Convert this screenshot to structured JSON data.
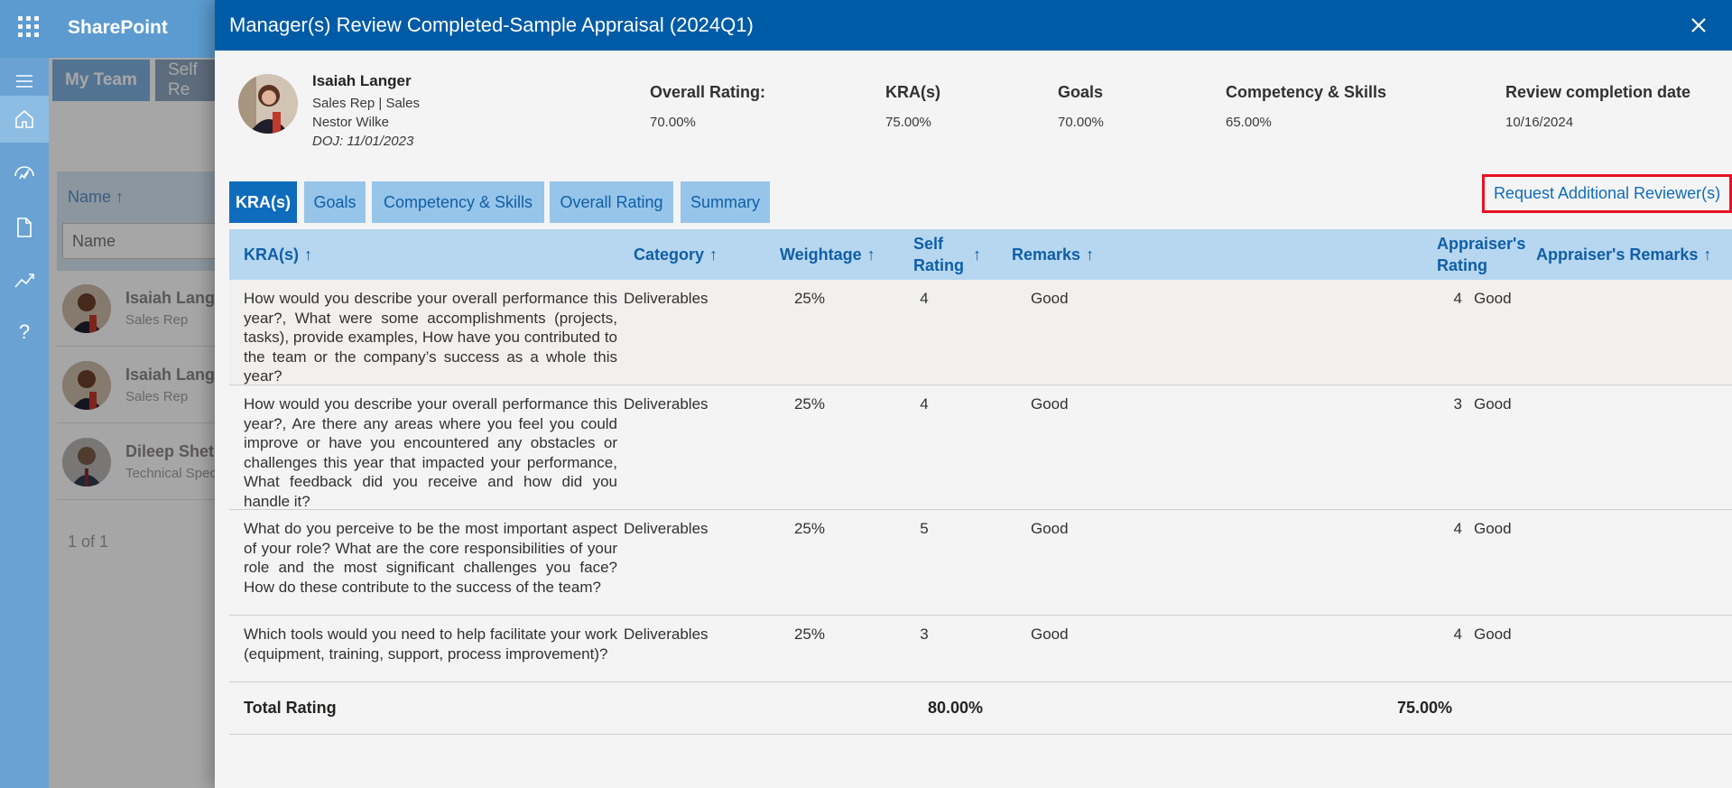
{
  "app": {
    "brand": "SharePoint",
    "tabs": [
      "My Team",
      "Self Re"
    ],
    "name_column_header": "Name ↑",
    "name_filter_placeholder": "Name",
    "people": [
      {
        "name": "Isaiah Lange",
        "role": "Sales Rep"
      },
      {
        "name": "Isaiah Lange",
        "role": "Sales Rep"
      },
      {
        "name": "Dileep Shet",
        "role": "Technical Spec"
      }
    ],
    "pager": "1 of 1",
    "rail_icons": [
      "menu-icon",
      "home-icon",
      "performance-icon",
      "document-icon",
      "chart-icon",
      "help-icon"
    ],
    "rail_help_glyph": "?"
  },
  "modal": {
    "title": "Manager(s) Review Completed-Sample Appraisal (2024Q1)",
    "employee": {
      "name": "Isaiah Langer",
      "title_dept": "Sales Rep | Sales",
      "manager": "Nestor Wilke",
      "doj": "DOJ: 11/01/2023"
    },
    "summary": [
      {
        "label": "Overall Rating:",
        "value": "70.00%"
      },
      {
        "label": "KRA(s)",
        "value": "75.00%"
      },
      {
        "label": "Goals",
        "value": "70.00%"
      },
      {
        "label": "Competency & Skills",
        "value": "65.00%"
      },
      {
        "label": "Review completion date",
        "value": "10/16/2024"
      }
    ],
    "tabs": [
      "KRA(s)",
      "Goals",
      "Competency & Skills",
      "Overall Rating",
      "Summary"
    ],
    "active_tab": "KRA(s)",
    "request_link": "Request Additional Reviewer(s)",
    "table": {
      "headers": {
        "kra": "KRA(s)",
        "category": "Category",
        "weightage": "Weightage",
        "self_rating_1": "Self",
        "self_rating_2": "Rating",
        "remarks": "Remarks",
        "appraiser_rating_1": "Appraiser's",
        "appraiser_rating_2": "Rating",
        "appraiser_remarks": "Appraiser's Remarks",
        "sort_arrow": "↑"
      },
      "rows": [
        {
          "kra": "How would you describe your overall performance this year?, What were some accomplishments (projects, tasks), provide examples, How have you contributed to the team or the company’s success as a whole this year?",
          "category": "Deliverables",
          "weightage": "25%",
          "self_rating": "4",
          "remarks": "Good",
          "appraiser_rating": "4",
          "appraiser_remarks": "Good"
        },
        {
          "kra": "How would you describe your overall performance this year?, Are there any areas where you feel you could improve or have you encountered any obstacles or challenges this year that impacted your performance, What feedback did you receive and how did you handle it?",
          "category": "Deliverables",
          "weightage": "25%",
          "self_rating": "4",
          "remarks": "Good",
          "appraiser_rating": "3",
          "appraiser_remarks": "Good"
        },
        {
          "kra": "What do you perceive to be the most important aspect of your role? What are the core responsibilities of your role and the most significant challenges you face? How do these contribute to the success of the team?",
          "category": "Deliverables",
          "weightage": "25%",
          "self_rating": "5",
          "remarks": "Good",
          "appraiser_rating": "4",
          "appraiser_remarks": "Good"
        },
        {
          "kra": "Which tools would you need to help facilitate your work (equipment, training, support, process improvement)?",
          "category": "Deliverables",
          "weightage": "25%",
          "self_rating": "3",
          "remarks": "Good",
          "appraiser_rating": "4",
          "appraiser_remarks": "Good"
        }
      ],
      "total": {
        "label": "Total Rating",
        "self": "80.00%",
        "appraiser": "75.00%"
      }
    }
  },
  "colors": {
    "header_blue": "#005ba7",
    "tab_active": "#0f6cbd",
    "tab_inactive": "#97c5ea",
    "table_header": "#b7d6ef",
    "highlight_red": "#e81123"
  }
}
